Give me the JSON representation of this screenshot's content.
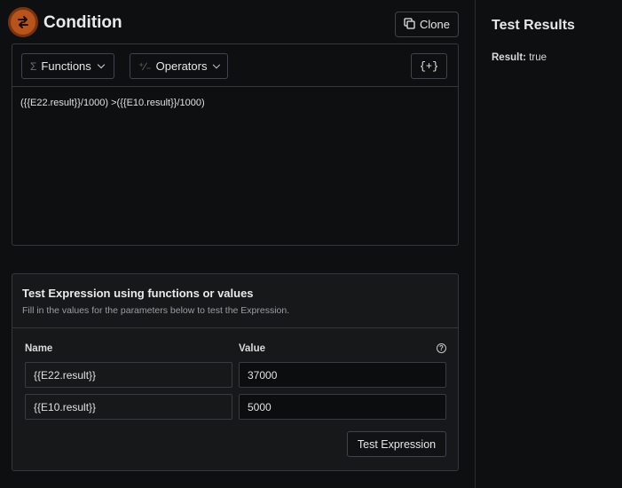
{
  "header": {
    "title": "Condition",
    "clone_label": "Clone"
  },
  "toolbar": {
    "functions_label": "Functions",
    "operators_label": "Operators",
    "variables_label": "{+}"
  },
  "editor": {
    "expression": "({{E22.result}}/1000) >({{E10.result}}/1000)"
  },
  "test_panel": {
    "title": "Test Expression using functions or values",
    "subtitle": "Fill in the values for the parameters below to test the Expression.",
    "name_header": "Name",
    "value_header": "Value",
    "rows": [
      {
        "name": "{{E22.result}}",
        "value": "37000"
      },
      {
        "name": "{{E10.result}}",
        "value": "5000"
      }
    ],
    "test_button_label": "Test Expression"
  },
  "results": {
    "title": "Test Results",
    "result_label": "Result:",
    "result_value": "true"
  },
  "colors": {
    "background": "#0e0f10",
    "accent_icon": "#b6541c",
    "border": "#34373b"
  },
  "icons": {
    "condition": "condition-icon",
    "clone": "copy-icon",
    "functions": "sigma-icon",
    "operators": "operators-icon",
    "help": "help-icon"
  }
}
